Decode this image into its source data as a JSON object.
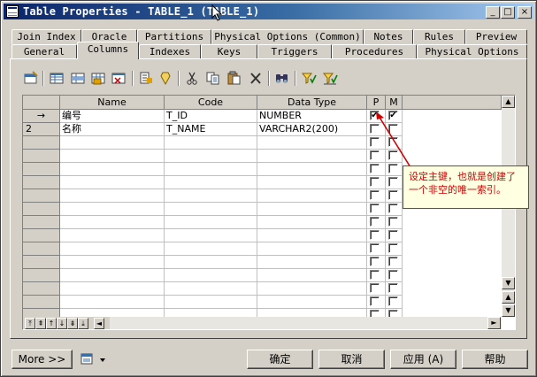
{
  "window": {
    "title": "Table Properties - TABLE_1 (TABLE_1)",
    "controls": [
      "_",
      "□",
      "×"
    ]
  },
  "tabs_row1": [
    "Join Index",
    "Oracle",
    "Partitions",
    "Physical Options (Common)",
    "Notes",
    "Rules",
    "Preview"
  ],
  "tabs_row2": [
    "General",
    "Columns",
    "Indexes",
    "Keys",
    "Triggers",
    "Procedures",
    "Physical Options"
  ],
  "active_tab": "Columns",
  "toolbar": {
    "icons": [
      "properties-icon",
      "add-row-icon",
      "insert-row-icon",
      "add-columns-icon",
      "delete-all-icon",
      "customize-columns-icon",
      "cut-icon",
      "copy-icon",
      "paste-icon",
      "delete-icon",
      "find-icon",
      "filter-icon",
      "clear-filter-icon"
    ]
  },
  "grid": {
    "headers": {
      "name": "Name",
      "code": "Code",
      "data_type": "Data Type",
      "p": "P",
      "m": "M"
    },
    "rows": [
      {
        "indicator": "→",
        "name": "编号",
        "code": "T_ID",
        "data_type": "NUMBER",
        "p": true,
        "m": true
      },
      {
        "indicator": "2",
        "name": "名称",
        "code": "T_NAME",
        "data_type": "VARCHAR2(200)",
        "p": false,
        "m": false
      }
    ],
    "empty_rows": 14
  },
  "annotation": {
    "text": "设定主键，也就是创建了一个非空的唯一索引。",
    "color": "#cc0000"
  },
  "footer": {
    "more": "More >>",
    "ok": "确定",
    "cancel": "取消",
    "apply": "应用 (A)",
    "help": "帮助"
  }
}
